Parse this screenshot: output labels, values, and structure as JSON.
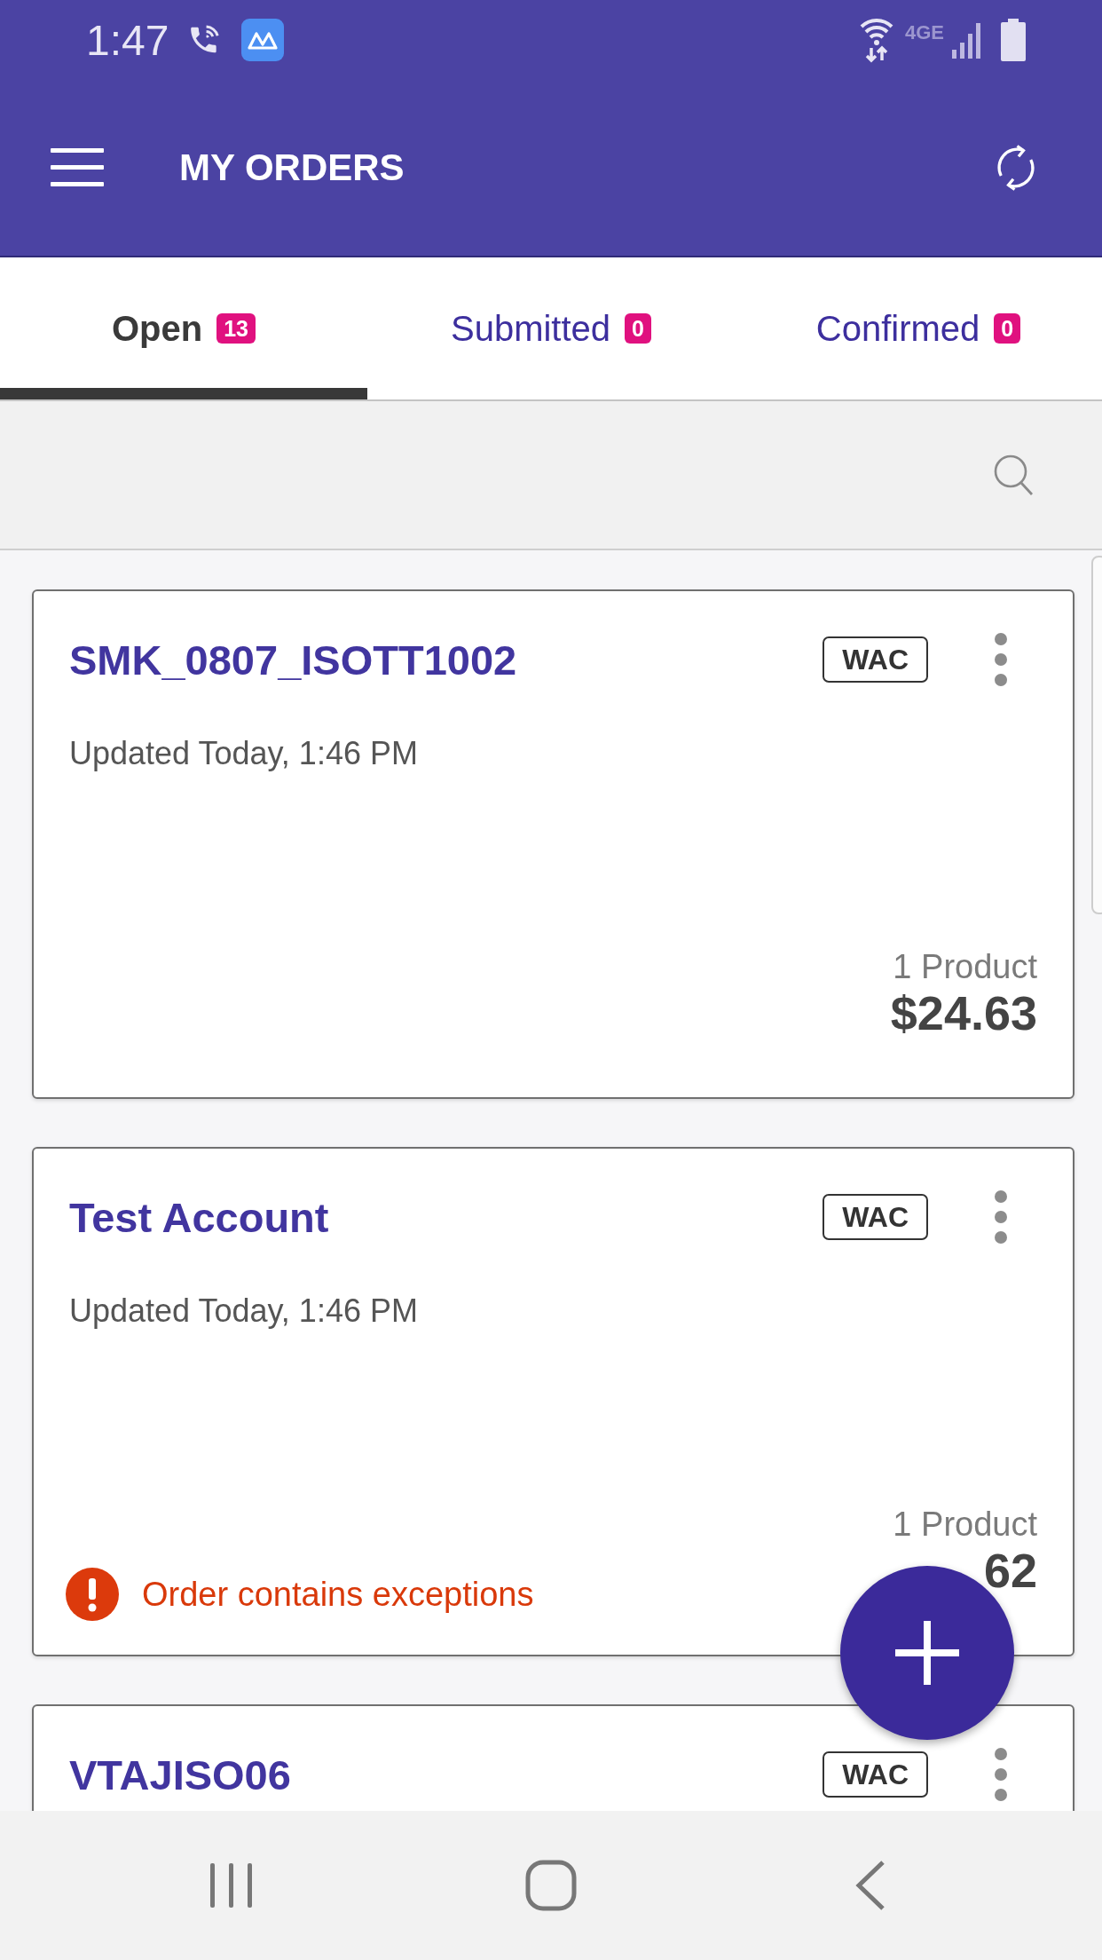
{
  "status_bar": {
    "time": "1:47",
    "network": "4GE"
  },
  "app_bar": {
    "title": "MY ORDERS"
  },
  "tabs": [
    {
      "label": "Open",
      "count": "13",
      "selected": true
    },
    {
      "label": "Submitted",
      "count": "0",
      "selected": false
    },
    {
      "label": "Confirmed",
      "count": "0",
      "selected": false
    }
  ],
  "orders": [
    {
      "name": "SMK_0807_ISOTT1002",
      "price_type": "WAC",
      "updated": "Updated Today, 1:46 PM",
      "products": "1 Product",
      "total": "$24.63"
    },
    {
      "name": "Test Account",
      "price_type": "WAC",
      "updated": "Updated Today, 1:46 PM",
      "products": "1 Product",
      "total": "62",
      "warning": "Order contains exceptions"
    },
    {
      "name": "VTAJISO06",
      "price_type": "WAC"
    }
  ]
}
